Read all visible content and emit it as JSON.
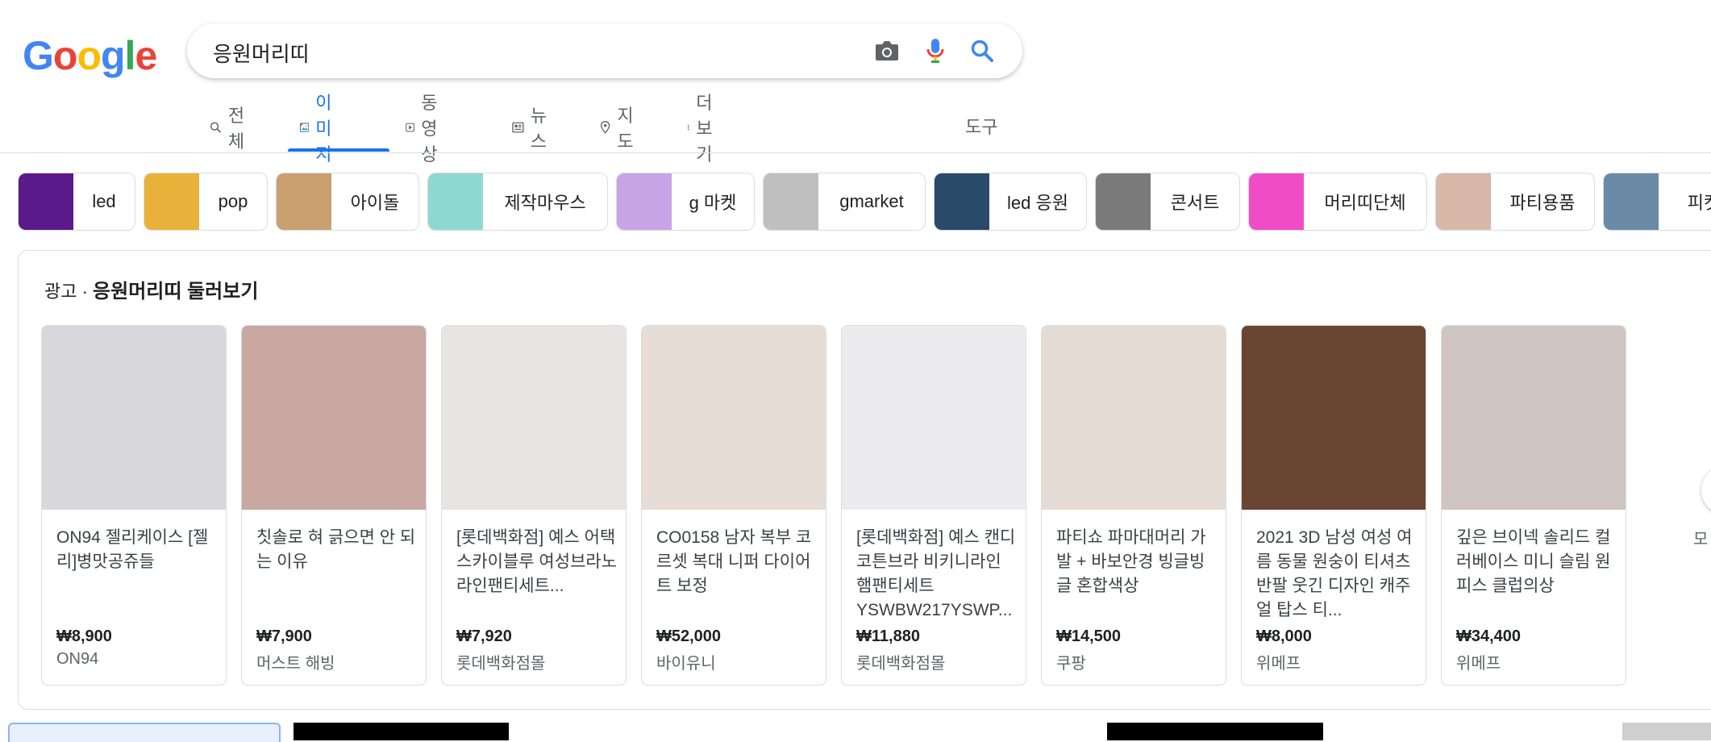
{
  "logo": {
    "letters": [
      "G",
      "o",
      "o",
      "g",
      "l",
      "e"
    ],
    "colors": [
      "#4285F4",
      "#EA4335",
      "#FBBC05",
      "#4285F4",
      "#34A853",
      "#EA4335"
    ]
  },
  "search": {
    "query": "응원머리띠"
  },
  "icons": {
    "camera": "camera-icon",
    "mic": "mic-icon",
    "search": "search-icon"
  },
  "tabs": [
    {
      "label": "전체",
      "icon": "search-icon"
    },
    {
      "label": "이미지",
      "icon": "image-icon",
      "active": true
    },
    {
      "label": "동영상",
      "icon": "video-icon"
    },
    {
      "label": "뉴스",
      "icon": "news-icon"
    },
    {
      "label": "지도",
      "icon": "map-pin-icon"
    },
    {
      "label": "더보기",
      "icon": "more-vert-icon"
    }
  ],
  "tools_label": "도구",
  "chips": [
    {
      "label": "led",
      "color": "#5a1a8a"
    },
    {
      "label": "pop",
      "color": "#e8b23a"
    },
    {
      "label": "아이돌",
      "color": "#c9a070"
    },
    {
      "label": "제작마우스",
      "color": "#8fd8d2"
    },
    {
      "label": "g 마켓",
      "color": "#c7a4e6"
    },
    {
      "label": "gmarket",
      "color": "#bfbfbf"
    },
    {
      "label": "led 응원",
      "color": "#2a4a6a"
    },
    {
      "label": "콘서트",
      "color": "#7a7a7a"
    },
    {
      "label": "머리띠단체",
      "color": "#f04cc8"
    },
    {
      "label": "파티용품",
      "color": "#d8b8a8"
    },
    {
      "label": "피켓",
      "color": "#6a8aa8"
    }
  ],
  "ad": {
    "prefix": "광고 · ",
    "title": "응원머리띠 둘러보기",
    "cards": [
      {
        "title": "ON94 젤리케이스 [젤리]병맛공쥬들",
        "price": "₩8,900",
        "store": "ON94",
        "color": "#d8d8dc"
      },
      {
        "title": "칫솔로 혀 긁으면 안 되는 이유",
        "price": "₩7,900",
        "store": "머스트 해빙",
        "color": "#c8a8a0"
      },
      {
        "title": "[롯데백화점] 예스 어택 스카이블루 여성브라노라인팬티세트...",
        "price": "₩7,920",
        "store": "롯데백화점몰",
        "color": "#e8e4e2"
      },
      {
        "title": "CO0158 남자 복부 코르셋 복대 니퍼 다이어트 보정",
        "price": "₩52,000",
        "store": "바이유니",
        "color": "#e6ddd6"
      },
      {
        "title": "[롯데백화점] 예스 캔디코튼브라 비키니라인 햄팬티세트 YSWBW217YSWP...",
        "price": "₩11,880",
        "store": "롯데백화점몰",
        "color": "#ecebee"
      },
      {
        "title": "파티쇼 파마대머리 가발 + 바보안경 빙글빙글 혼합색상",
        "price": "₩14,500",
        "store": "쿠팡",
        "color": "#e4dcd4"
      },
      {
        "title": "2021 3D 남성 여성 여름 동물 원숭이 티셔츠 반팔 웃긴 디자인 캐주얼 탑스 티...",
        "price": "₩8,000",
        "store": "위메프",
        "color": "#6a4632"
      },
      {
        "title": "깊은 브이넥 솔리드 컬러베이스 미니 슬림 원피스 클럽의상",
        "price": "₩34,400",
        "store": "위메프",
        "color": "#cfc6c2"
      }
    ]
  },
  "more_label": "모"
}
